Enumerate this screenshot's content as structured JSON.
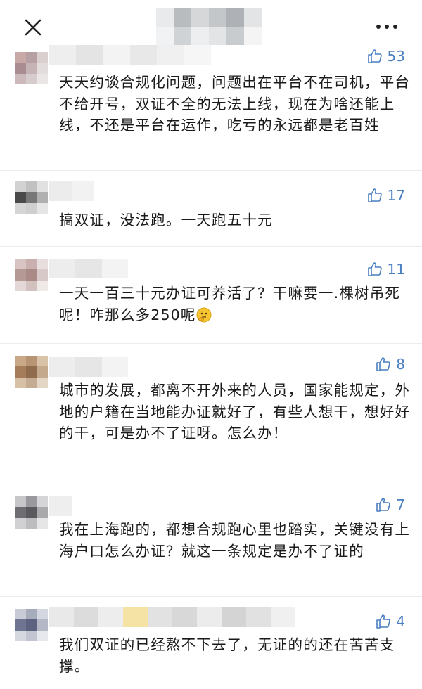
{
  "header": {
    "close_icon": "close-icon",
    "more_icon": "more-horizontal-icon"
  },
  "colors": {
    "like_blue": "#4a7fc1",
    "text": "#1a1a1a"
  },
  "comments": [
    {
      "likes": "53",
      "text": "天天约谈合规化问题，问题出在平台不在司机，平台不给开号，双证不全的无法上线，现在为啥还能上线，不还是平台在运作，吃亏的永远都是老百姓"
    },
    {
      "likes": "17",
      "text": "搞双证，没法跑。一天跑五十元"
    },
    {
      "likes": "11",
      "text": "一天一百三十元办证可养活了？干嘛要一.棵树吊死呢！咋那么多250呢",
      "emoji": "thinking-face-emoji"
    },
    {
      "likes": "8",
      "text": "城市的发展，都离不开外来的人员，国家能规定，外地的户籍在当地能办证就好了，有些人想干，想好好的干，可是办不了证呀。怎么办！"
    },
    {
      "likes": "7",
      "text": "我在上海跑的，都想合规跑心里也踏实，关键没有上海户口怎么办证？就这一条规定是办不了证的"
    },
    {
      "likes": "4",
      "text": "我们双证的已经熬不下去了，无证的的还在苦苦支撑。"
    }
  ]
}
